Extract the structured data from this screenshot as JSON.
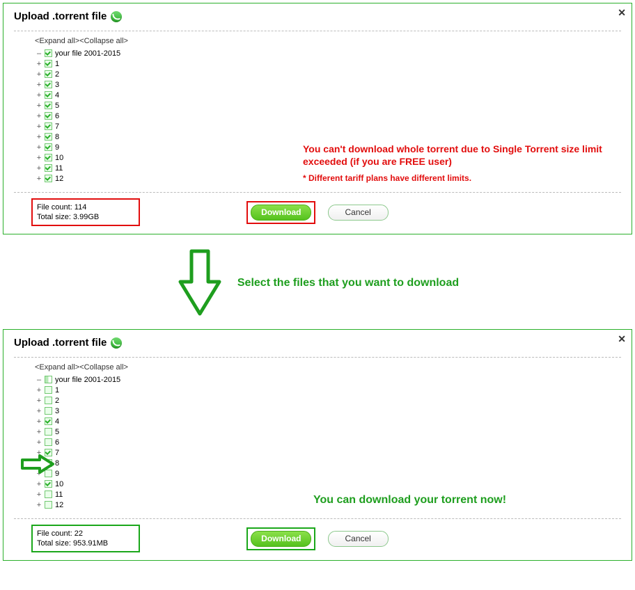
{
  "panel1": {
    "title": "Upload .torrent file",
    "expand_label": "<Expand all>",
    "collapse_label": "<Collapse all>",
    "root_name": "your file 2001-2015",
    "items": [
      {
        "label": "1",
        "checked": true
      },
      {
        "label": "2",
        "checked": true
      },
      {
        "label": "3",
        "checked": true
      },
      {
        "label": "4",
        "checked": true
      },
      {
        "label": "5",
        "checked": true
      },
      {
        "label": "6",
        "checked": true
      },
      {
        "label": "7",
        "checked": true
      },
      {
        "label": "8",
        "checked": true
      },
      {
        "label": "9",
        "checked": true
      },
      {
        "label": "10",
        "checked": true
      },
      {
        "label": "11",
        "checked": true
      },
      {
        "label": "12",
        "checked": true
      }
    ],
    "file_count_label": "File count: 114",
    "total_size_label": "Total size: 3.99GB",
    "download_label": "Download",
    "cancel_label": "Cancel",
    "anno_main": "You can't download whole torrent due to Single Torrent size limit exceeded (if you are FREE user)",
    "anno_sub": "* Different tariff plans have different limits."
  },
  "middle_text": "Select the files that you want to download",
  "panel2": {
    "title": "Upload .torrent file",
    "expand_label": "<Expand all>",
    "collapse_label": "<Collapse all>",
    "root_name": "your file 2001-2015",
    "items": [
      {
        "label": "1",
        "checked": false
      },
      {
        "label": "2",
        "checked": false
      },
      {
        "label": "3",
        "checked": false
      },
      {
        "label": "4",
        "checked": true
      },
      {
        "label": "5",
        "checked": false
      },
      {
        "label": "6",
        "checked": false
      },
      {
        "label": "7",
        "checked": true
      },
      {
        "label": "8",
        "checked": false
      },
      {
        "label": "9",
        "checked": false
      },
      {
        "label": "10",
        "checked": true
      },
      {
        "label": "11",
        "checked": false
      },
      {
        "label": "12",
        "checked": false
      }
    ],
    "file_count_label": "File count: 22",
    "total_size_label": "Total size: 953.91MB",
    "download_label": "Download",
    "cancel_label": "Cancel",
    "anno_main": "You can download your torrent now!"
  }
}
